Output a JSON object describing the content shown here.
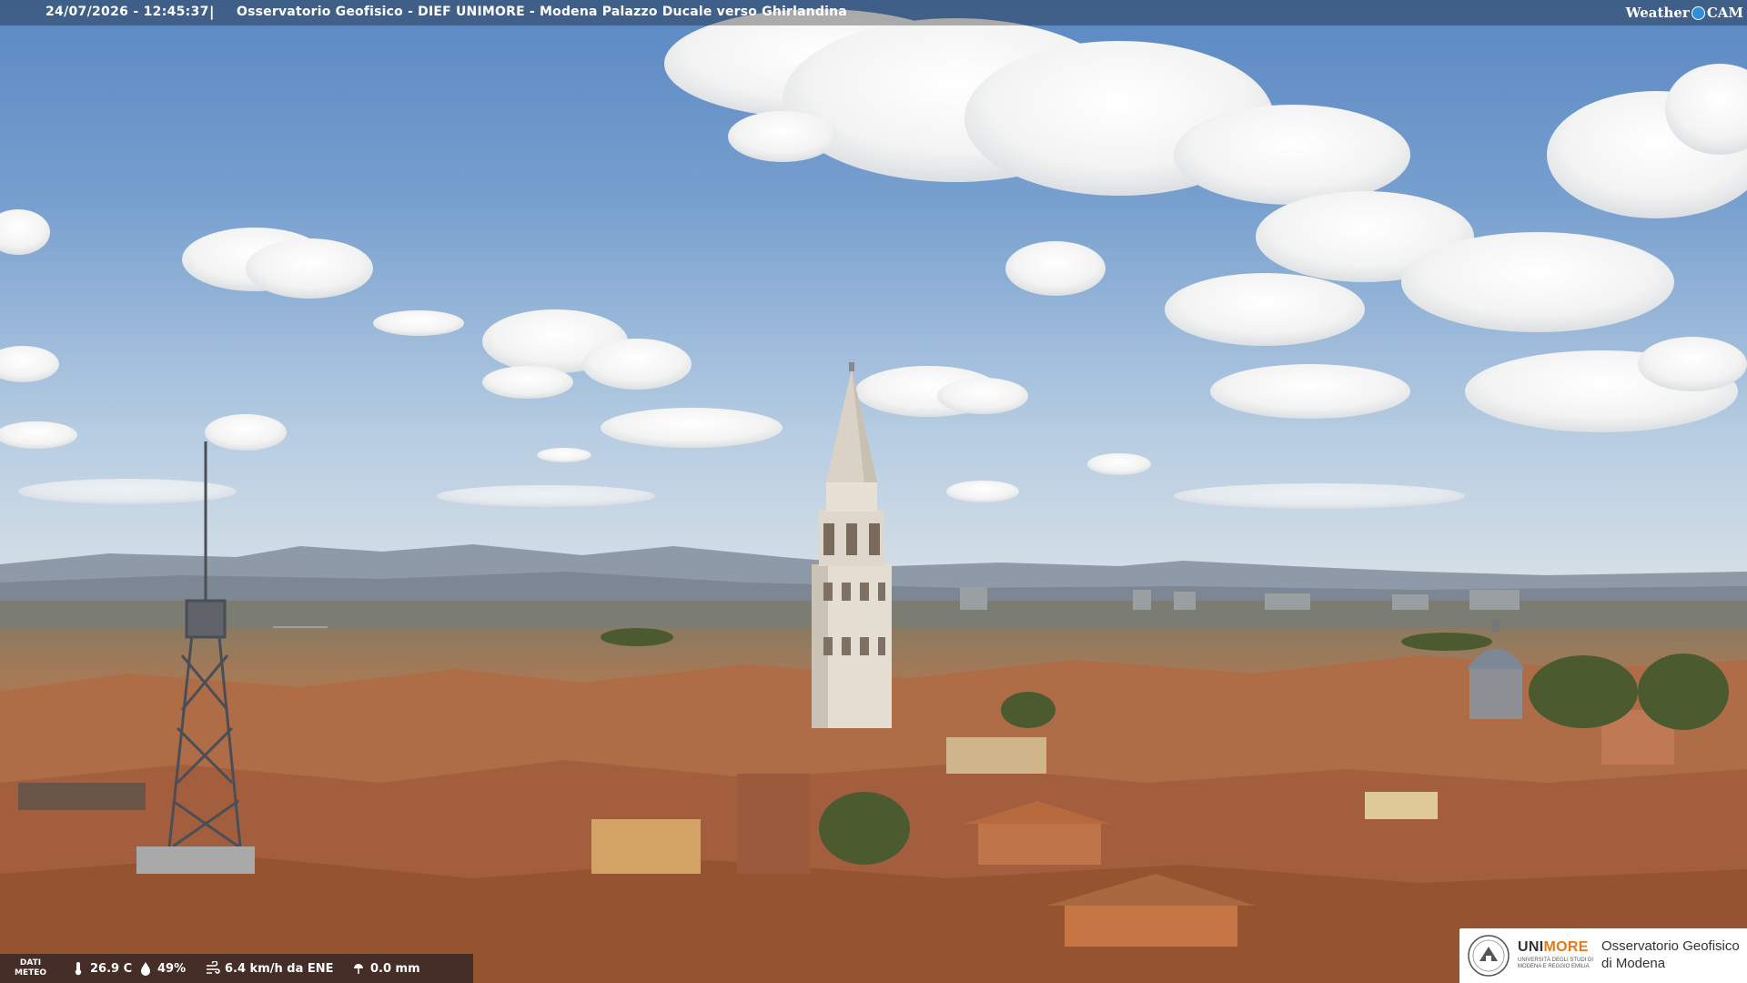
{
  "header": {
    "timestamp": "24/07/2026 - 12:45:37",
    "separator": "|",
    "title": "Osservatorio Geofisico - DIEF UNIMORE - Modena Palazzo Ducale verso Ghirlandina"
  },
  "brand": {
    "weathercam_left": "Weather",
    "weathercam_right": "CAM"
  },
  "weather": {
    "label_line1": "DATI",
    "label_line2": "METEO",
    "temperature": "26.9 C",
    "humidity": "49%",
    "wind": "6.4 km/h da ENE",
    "rain": "0.0 mm"
  },
  "institution": {
    "uni_part1": "UNI",
    "uni_part2": "MORE",
    "uni_sub_line1": "UNIVERSITÀ DEGLI STUDI DI",
    "uni_sub_line2": "MODENA E REGGIO EMILIA",
    "observatory_line1": "Osservatorio Geofisico",
    "observatory_line2": "di Modena"
  },
  "colors": {
    "sky_top": "#5f8cc4",
    "sky_horizon": "#c9d8e6",
    "roofs": "#b8724a",
    "tower": "#e6e0d5",
    "uni_accent": "#e77817"
  }
}
